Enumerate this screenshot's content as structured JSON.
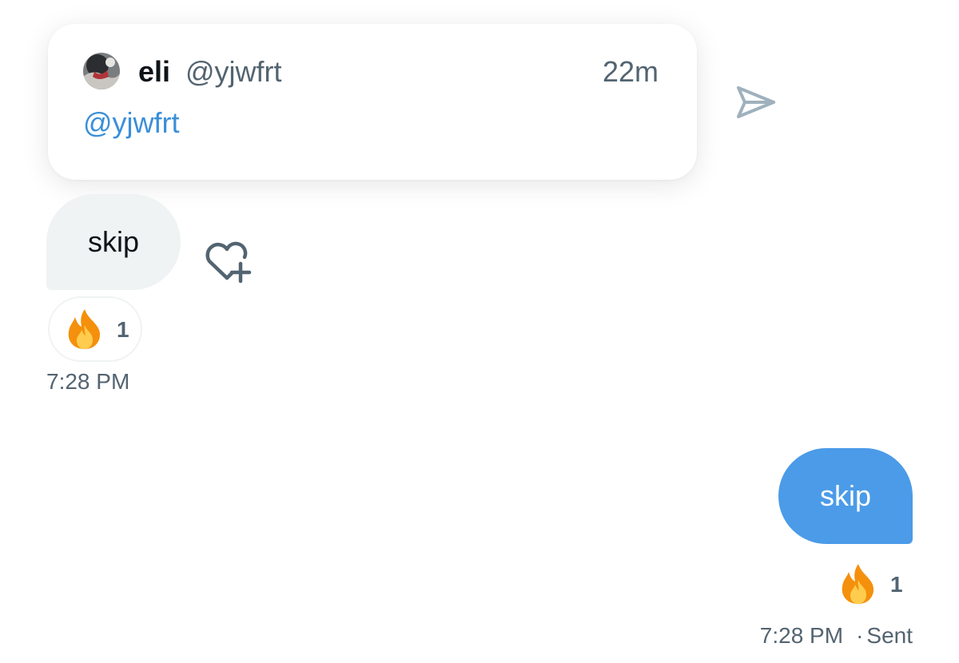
{
  "shared_tweet": {
    "author_name": "eli",
    "author_handle": "@yjwfrt",
    "time_ago": "22m",
    "body": "@yjwfrt"
  },
  "received_message": {
    "text": "skip",
    "reaction": {
      "emoji": "fire",
      "count": "1"
    },
    "timestamp": "7:28 PM"
  },
  "sent_message": {
    "text": "skip",
    "reaction": {
      "emoji": "fire",
      "count": "1"
    },
    "timestamp": "7:28 PM",
    "separator": "·",
    "status": "Sent"
  },
  "colors": {
    "sent_bubble": "#4b9be8",
    "received_bubble": "#eff3f4",
    "link_blue": "#3b8fd8",
    "secondary_text": "#536471",
    "icon_gray": "#9fb1bd"
  },
  "icons": {
    "share": "paper-plane-icon",
    "add_reaction": "heart-plus-icon",
    "reaction": "fire-icon"
  }
}
